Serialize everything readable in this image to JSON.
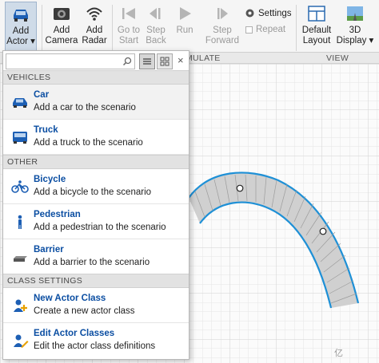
{
  "toolstrip": {
    "add_actor": {
      "line1": "Add",
      "line2": "Actor ▾"
    },
    "add_camera": {
      "line1": "Add",
      "line2": "Camera"
    },
    "add_radar": {
      "line1": "Add",
      "line2": "Radar"
    },
    "go_to_start": {
      "line1": "Go to",
      "line2": "Start"
    },
    "step_back": {
      "line1": "Step",
      "line2": "Back"
    },
    "run": {
      "line1": "Run",
      "line2": ""
    },
    "step_forward": {
      "line1": "Step",
      "line2": "Forward"
    },
    "settings_label": "Settings",
    "repeat_label": "Repeat",
    "default_layout": {
      "line1": "Default",
      "line2": "Layout"
    },
    "display_3d": {
      "line1": "3D",
      "line2": "Display ▾"
    },
    "section_simulate": "MULATE",
    "section_view": "VIEW"
  },
  "dropdown": {
    "search_value": "",
    "close_glyph": "×",
    "groups": {
      "vehicles": "VEHICLES",
      "other": "OTHER",
      "class_settings": "CLASS SETTINGS"
    },
    "items": {
      "car": {
        "title": "Car",
        "desc": "Add a car to the scenario"
      },
      "truck": {
        "title": "Truck",
        "desc": "Add a truck to the scenario"
      },
      "bicycle": {
        "title": "Bicycle",
        "desc": "Add a bicycle to the scenario"
      },
      "pedestrian": {
        "title": "Pedestrian",
        "desc": "Add a pedestrian to the scenario"
      },
      "barrier": {
        "title": "Barrier",
        "desc": "Add a barrier to the scenario"
      },
      "new_actor_class": {
        "title": "New Actor Class",
        "desc": "Create a new actor class"
      },
      "edit_actor_classes": {
        "title": "Edit Actor Classes",
        "desc": "Edit the actor class definitions"
      }
    }
  },
  "colors": {
    "accent_blue": "#0b4ea2",
    "road_edge": "#1e90d6",
    "road_fill": "#cfcfcf"
  },
  "watermark": "亿"
}
